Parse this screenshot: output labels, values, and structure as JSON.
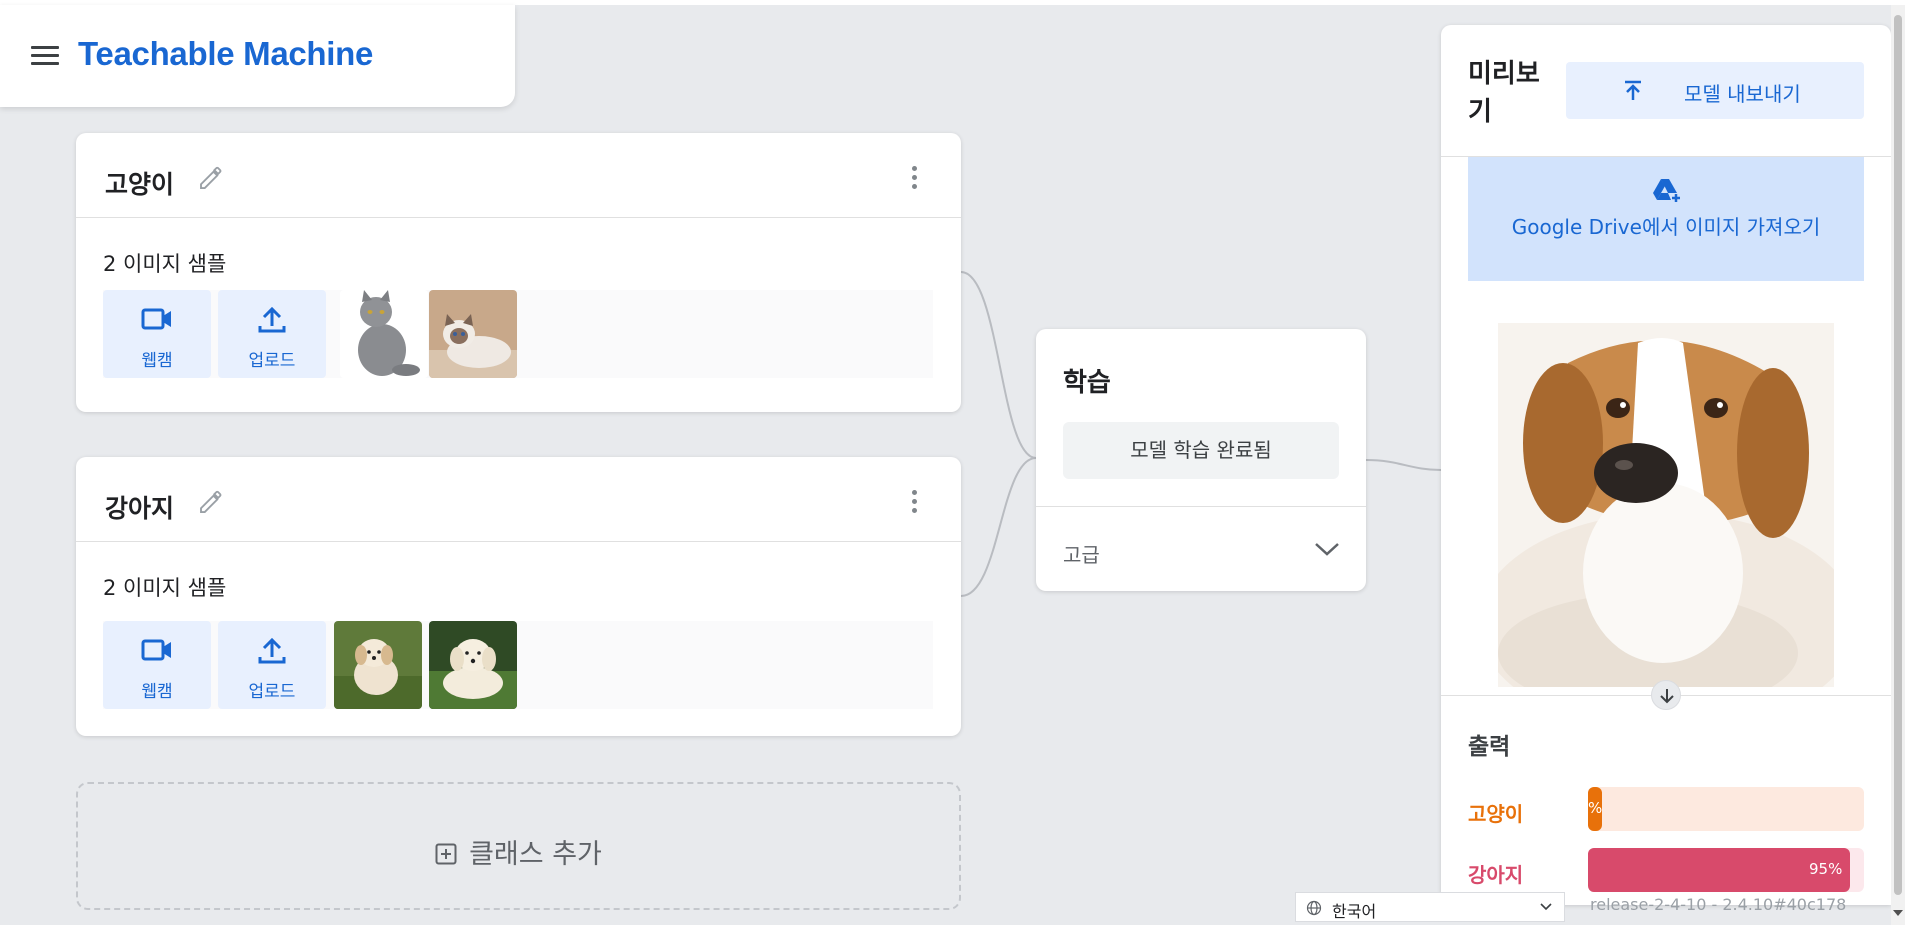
{
  "app": {
    "title": "Teachable Machine",
    "menu_icon": "hamburger-menu-icon"
  },
  "classes": [
    {
      "name": "고양이",
      "sample_count_text": "2 이미지 샘플",
      "webcam_label": "웹캠",
      "upload_label": "업로드",
      "samples": [
        "cat-sample-1",
        "cat-sample-2"
      ]
    },
    {
      "name": "강아지",
      "sample_count_text": "2 이미지 샘플",
      "webcam_label": "웹캠",
      "upload_label": "업로드",
      "samples": [
        "dog-sample-1",
        "dog-sample-2"
      ]
    }
  ],
  "add_class_label": "클래스 추가",
  "training": {
    "title": "학습",
    "button_label": "모델 학습 완료됨",
    "advanced_label": "고급"
  },
  "preview": {
    "title": "미리보기",
    "export_label": "모델 내보내기",
    "drive_label": "Google Drive에서 이미지 가져오기",
    "output_title": "출력",
    "outputs": [
      {
        "label": "고양이",
        "value": 0.05,
        "pct_text": "%",
        "color": "#e8710a",
        "track": "#fde9df"
      },
      {
        "label": "강아지",
        "value": 0.95,
        "pct_text": "95%",
        "color": "#d84a6b",
        "track": "#fce8ec"
      }
    ]
  },
  "footer": {
    "language": "한국어",
    "release": "release-2-4-10 - 2.4.10#40c178"
  },
  "colors": {
    "brand": "#1967d2",
    "background": "#e8eaed"
  }
}
